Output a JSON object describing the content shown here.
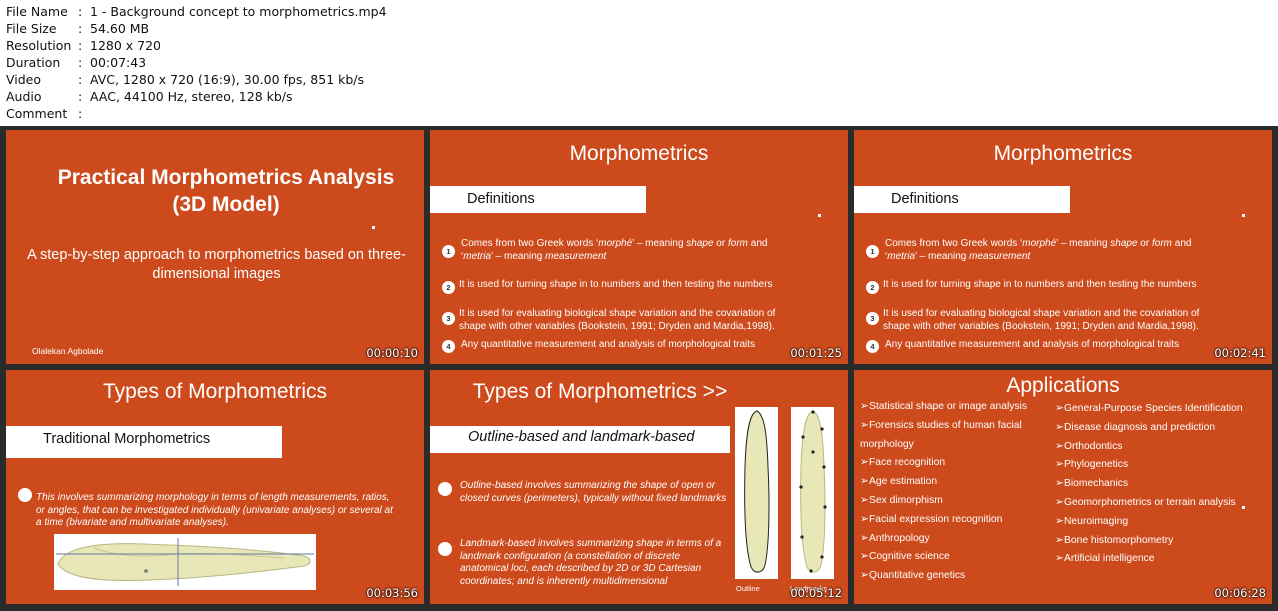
{
  "info": [
    {
      "key": "File Name",
      "value": "1 - Background concept to morphometrics.mp4"
    },
    {
      "key": "File Size",
      "value": "54.60 MB"
    },
    {
      "key": "Resolution",
      "value": "1280 x 720"
    },
    {
      "key": "Duration",
      "value": "00:07:43"
    },
    {
      "key": "Video",
      "value": "AVC, 1280 x 720 (16:9), 30.00 fps, 851 kb/s"
    },
    {
      "key": "Audio",
      "value": "AAC, 44100 Hz, stereo, 128 kb/s"
    },
    {
      "key": "Comment",
      "value": ""
    }
  ],
  "colon": ":",
  "thumbs": {
    "t1": {
      "title": "Practical Morphometrics Analysis (3D Model)",
      "subtitle": "A step-by-step approach to morphometrics based on three-dimensional images",
      "author": "Olalekan Agbolade",
      "time": "00:00:10"
    },
    "t2": {
      "title": "Morphometrics",
      "bar": "Definitions",
      "items": [
        {
          "n": "1",
          "pre": "Comes from two Greek words ‘",
          "w1": "morphé",
          "mid": "’ – meaning ",
          "w2": "shape",
          "or": " or ",
          "w3": "form",
          "and": " and ‘",
          "w4": "metria",
          "mid2": "’ – meaning ",
          "w5": "measurement"
        },
        {
          "n": "2",
          "text": "It is used for turning shape in to numbers and then testing the numbers"
        },
        {
          "n": "3",
          "text": "It is used for evaluating biological shape variation and the covariation of shape with other variables (Bookstein, 1991; Dryden and Mardia,1998)."
        },
        {
          "n": "4",
          "text": "Any quantitative measurement and analysis of morphological traits"
        }
      ],
      "time": "00:01:25"
    },
    "t3": {
      "time": "00:02:41"
    },
    "t4": {
      "title": "Types of Morphometrics",
      "bar": "Traditional Morphometrics",
      "text": "This involves summarizing morphology in terms of length measurements, ratios, or angles, that can be investigated individually (univariate analyses) or several at a time (bivariate and multivariate analyses).",
      "time": "00:03:56"
    },
    "t5": {
      "title": "Types of Morphometrics >>",
      "bar": "Outline-based and landmark-based",
      "p1": "Outline-based involves summarizing the shape of open or closed curves (perimeters), typically without fixed landmarks",
      "p2": "Landmark-based involves summarizing shape in terms of a landmark configuration (a constellation of discrete anatomical loci, each described by 2D or 3D Cartesian coordinates; and is inherently multidimensional",
      "cap1": "Outline",
      "cap2": "Landmarks",
      "time": "00:05:12"
    },
    "t6": {
      "title": "Applications",
      "arrow": "➢",
      "col1": [
        "Statistical shape or image analysis",
        "Forensics studies of human facial",
        "morphology",
        "Face  recognition",
        "Age  estimation",
        "Sex dimorphism",
        "Facial expression recognition",
        "Anthropology",
        "Cognitive  science",
        "Quantitative genetics"
      ],
      "col2": [
        "General-Purpose Species Identification",
        "Disease diagnosis and prediction",
        "Orthodontics",
        "Phylogenetics",
        "Biomechanics",
        "Geomorphometrics  or terrain  analysis",
        "Neuroimaging",
        "Bone histomorphometry",
        "Artificial intelligence"
      ],
      "time": "00:06:28"
    }
  }
}
